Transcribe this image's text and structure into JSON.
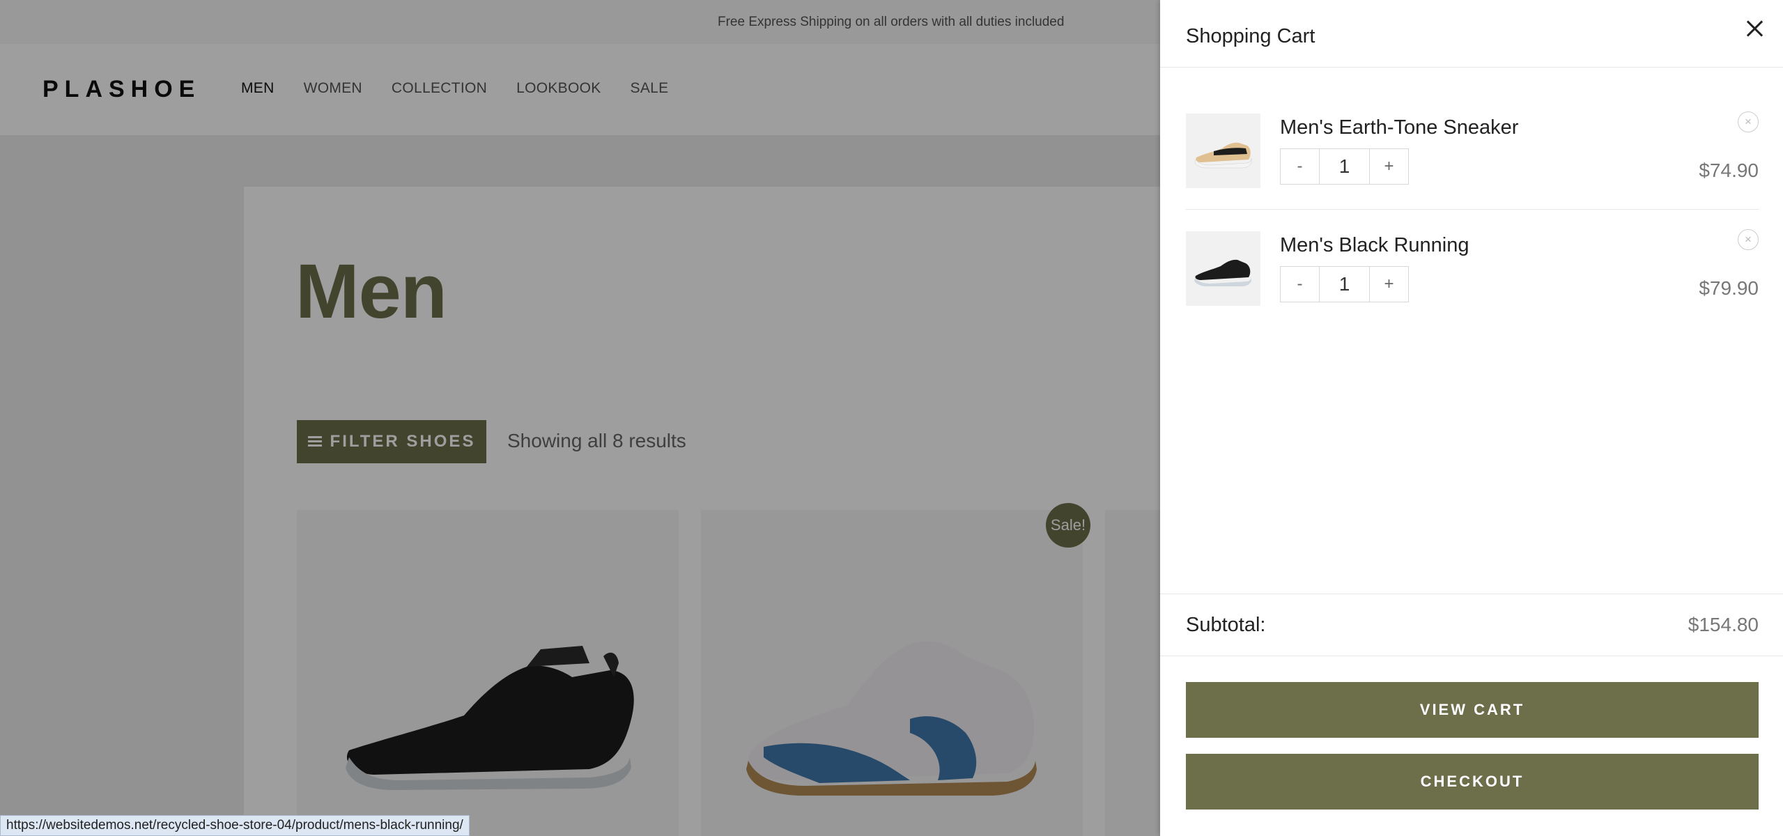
{
  "topbar": {
    "text": "Free Express Shipping on all orders with all duties included"
  },
  "header": {
    "logo": "PLASHOE",
    "nav": [
      "MEN",
      "WOMEN",
      "COLLECTION",
      "LOOKBOOK",
      "SALE"
    ]
  },
  "main": {
    "title": "Men",
    "filter_label": "FILTER SHOES",
    "results_text": "Showing all 8 results",
    "sale_badge": "Sale!"
  },
  "status_bar": {
    "url": "https://websitedemos.net/recycled-shoe-store-04/product/mens-black-running/"
  },
  "cart": {
    "title": "Shopping Cart",
    "items": [
      {
        "name": "Men's Earth-Tone Sneaker",
        "qty": "1",
        "minus": "-",
        "plus": "+",
        "price": "$74.90",
        "remove": "×"
      },
      {
        "name": "Men's Black Running",
        "qty": "1",
        "minus": "-",
        "plus": "+",
        "price": "$79.90",
        "remove": "×"
      }
    ],
    "subtotal_label": "Subtotal:",
    "subtotal_value": "$154.80",
    "view_cart": "VIEW CART",
    "checkout": "CHECKOUT"
  },
  "colors": {
    "accent": "#6d6e4a",
    "title": "#6c6f4b"
  }
}
